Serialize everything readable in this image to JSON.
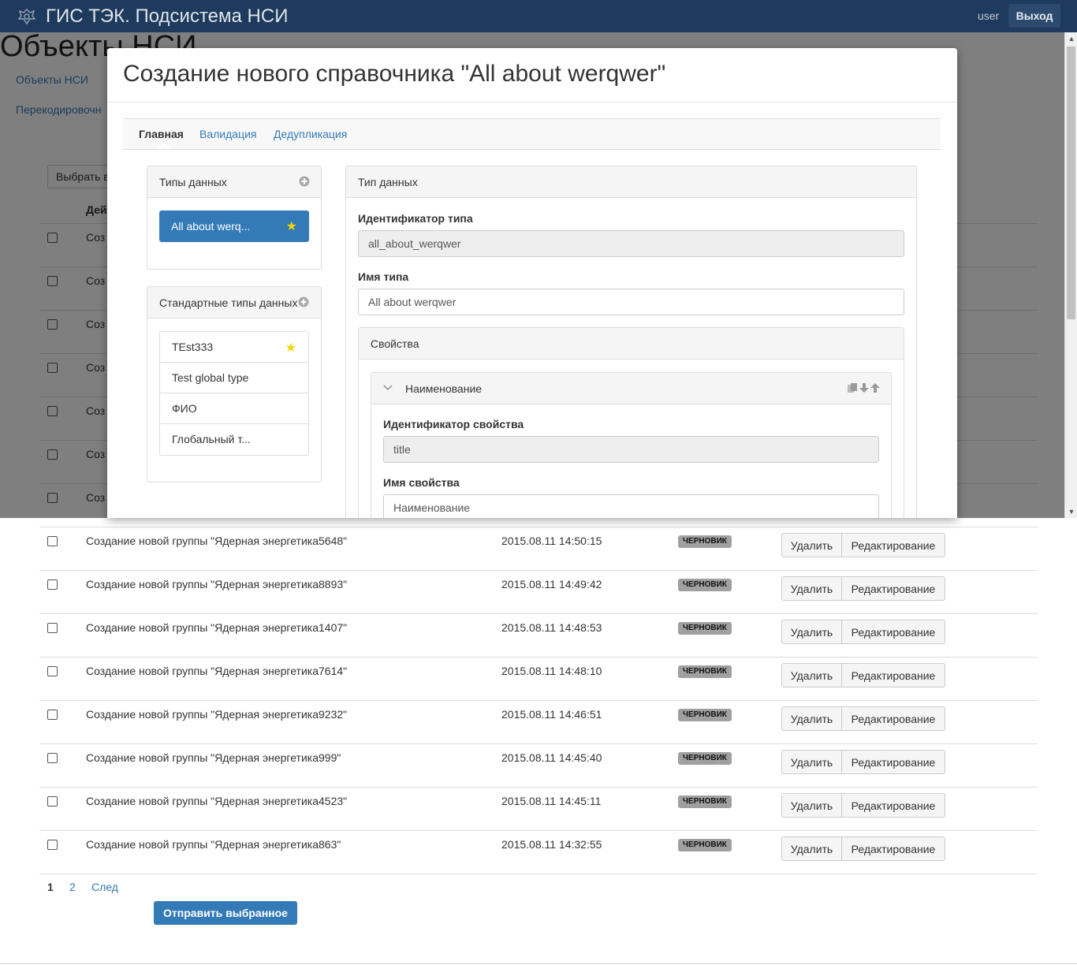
{
  "navbar": {
    "title": "ГИС ТЭК. Подсистема НСИ",
    "user": "user",
    "exit_label": "Выход"
  },
  "page": {
    "title": "Объекты НСИ",
    "nav_links": [
      "Объекты НСИ",
      "Перекодировочн"
    ],
    "select_label": "Выбрать в",
    "column_header": "Дей",
    "hidden_row_prefix": "Соз"
  },
  "modal": {
    "title": "Создание нового справочника \"All about werqwer\"",
    "tabs": [
      "Главная",
      "Валидация",
      "Дедупликация"
    ],
    "types_panel": {
      "heading": "Типы данных",
      "active_item": "All about werq..."
    },
    "standard_panel": {
      "heading": "Стандартные типы данных",
      "items": [
        "TEst333",
        "Test global type",
        "ФИО",
        "Глобальный т..."
      ]
    },
    "type_panel": {
      "heading": "Тип данных",
      "id_label": "Идентификатор типа",
      "id_value": "all_about_werqwer",
      "name_label": "Имя типа",
      "name_value": "All about werqwer",
      "props_heading": "Свойства",
      "prop": {
        "heading": "Наименование",
        "id_label": "Идентификатор свойства",
        "id_value": "title",
        "name_label": "Имя свойства",
        "name_value": "Наименование"
      }
    }
  },
  "rows": [
    {
      "name": "Создание новой группы \"Ядерная энергетика5648\"",
      "date": "2015.08.11 14:50:15",
      "status": "ЧЕРНОВИК"
    },
    {
      "name": "Создание новой группы \"Ядерная энергетика8893\"",
      "date": "2015.08.11 14:49:42",
      "status": "ЧЕРНОВИК"
    },
    {
      "name": "Создание новой группы \"Ядерная энергетика1407\"",
      "date": "2015.08.11 14:48:53",
      "status": "ЧЕРНОВИК"
    },
    {
      "name": "Создание новой группы \"Ядерная энергетика7614\"",
      "date": "2015.08.11 14:48:10",
      "status": "ЧЕРНОВИК"
    },
    {
      "name": "Создание новой группы \"Ядерная энергетика9232\"",
      "date": "2015.08.11 14:46:51",
      "status": "ЧЕРНОВИК"
    },
    {
      "name": "Создание новой группы \"Ядерная энергетика999\"",
      "date": "2015.08.11 14:45:40",
      "status": "ЧЕРНОВИК"
    },
    {
      "name": "Создание новой группы \"Ядерная энергетика4523\"",
      "date": "2015.08.11 14:45:11",
      "status": "ЧЕРНОВИК"
    },
    {
      "name": "Создание новой группы \"Ядерная энергетика863\"",
      "date": "2015.08.11 14:32:55",
      "status": "ЧЕРНОВИК"
    }
  ],
  "row_actions": {
    "delete": "Удалить",
    "edit": "Редактирование"
  },
  "pagination": {
    "pages": [
      "1",
      "2"
    ],
    "next": "След"
  },
  "send_label": "Отправить выбранное",
  "colors": {
    "navbar": "#1e3a5c",
    "accent": "#337ab7",
    "star": "#f5d300"
  }
}
